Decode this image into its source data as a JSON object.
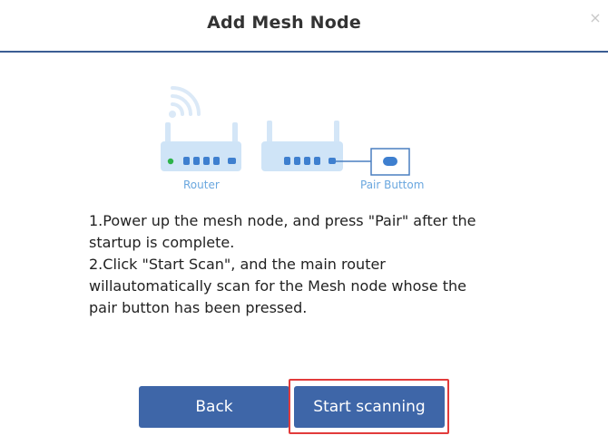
{
  "dialog": {
    "title": "Add Mesh Node",
    "close_glyph": "×"
  },
  "illustration": {
    "router_caption": "Router",
    "pair_caption": "Pair Buttom",
    "icons": [
      "wifi-signal-icon",
      "router-icon",
      "mesh-node-icon",
      "pair-button-icon"
    ],
    "colors": {
      "device": "#cfe4f7",
      "signal": "#dbe9f7",
      "ports": "#3e7fcf",
      "power_led": "#2db34a",
      "callout": "#4a7fc0"
    }
  },
  "instructions": {
    "step1": "1.Power up the mesh node, and press \"Pair\" after the startup is complete.",
    "step2": "2.Click \"Start Scan\", and the main router willautomatically scan for the Mesh node whose the pair button has been pressed."
  },
  "buttons": {
    "back": "Back",
    "start": "Start scanning"
  },
  "colors": {
    "accent": "#3e66a8",
    "header_rule": "#3b5d93",
    "highlight": "#e23b3b"
  }
}
